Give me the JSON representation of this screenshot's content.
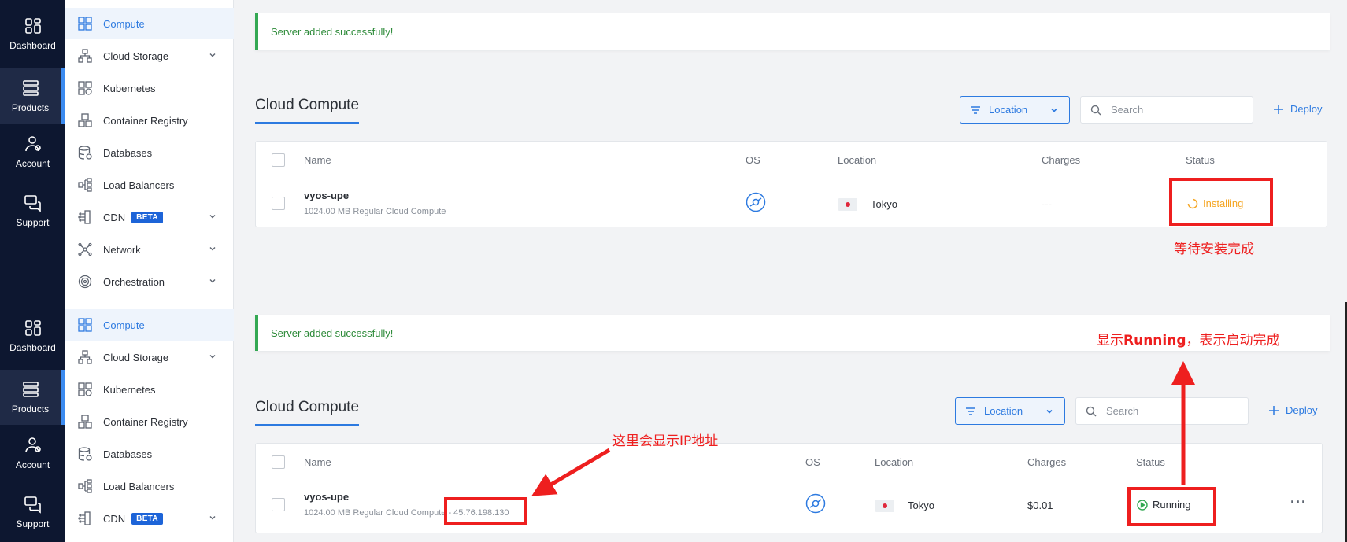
{
  "rail": {
    "dashboard": "Dashboard",
    "products": "Products",
    "account": "Account",
    "support": "Support"
  },
  "menu": {
    "items": [
      {
        "label": "Compute",
        "icon": "compute-icon",
        "active": true
      },
      {
        "label": "Cloud Storage",
        "icon": "cloud-storage-icon",
        "chevron": true
      },
      {
        "label": "Kubernetes",
        "icon": "kubernetes-icon"
      },
      {
        "label": "Container Registry",
        "icon": "container-registry-icon"
      },
      {
        "label": "Databases",
        "icon": "databases-icon"
      },
      {
        "label": "Load Balancers",
        "icon": "load-balancers-icon"
      },
      {
        "label": "CDN",
        "icon": "cdn-icon",
        "badge": "BETA",
        "chevron": true
      },
      {
        "label": "Network",
        "icon": "network-icon",
        "chevron": true
      },
      {
        "label": "Orchestration",
        "icon": "orchestration-icon",
        "chevron": true
      }
    ]
  },
  "alert": "Server added successfully!",
  "page_title": "Cloud Compute",
  "toolbar": {
    "location": "Location",
    "search_placeholder": "Search",
    "deploy": "Deploy"
  },
  "table": {
    "headers": [
      "Name",
      "OS",
      "Location",
      "Charges",
      "Status"
    ]
  },
  "panel1": {
    "server_name": "vyos-upe",
    "server_desc": "1024.00 MB Regular Cloud Compute",
    "location": "Tokyo",
    "charges": "---",
    "status": "Installing",
    "annotation": "等待安装完成"
  },
  "panel2": {
    "server_name": "vyos-upe",
    "server_desc": "1024.00 MB Regular Cloud Compute - 45.76.198.130",
    "location": "Tokyo",
    "charges": "$0.01",
    "status": "Running",
    "more": "···",
    "annotation_ip": "这里会显示IP地址",
    "annotation_running_pre": "显示",
    "annotation_running_bold": "Running",
    "annotation_running_post": "，表示启动完成"
  },
  "colors": {
    "accent": "#2d7ae0",
    "success": "#34a853",
    "installing": "#f5a623",
    "annotation": "#ee1f1f",
    "rail": "#0d1730"
  }
}
